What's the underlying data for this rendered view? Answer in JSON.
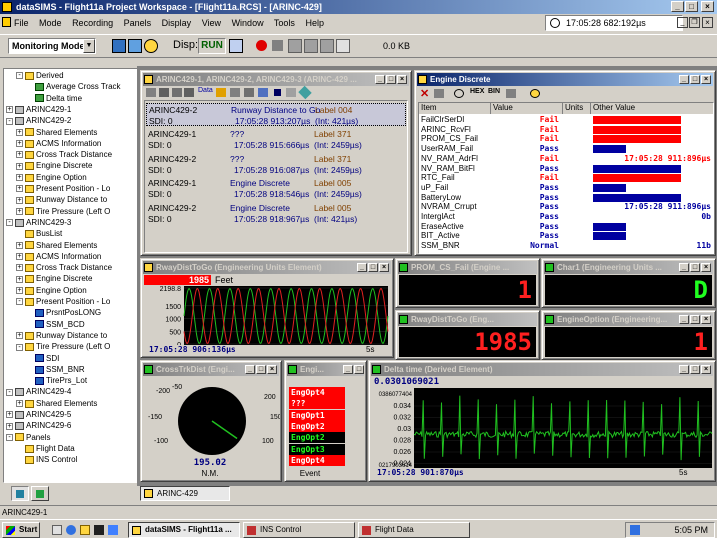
{
  "app": {
    "title": "dataSIMS - Flight11a Project Workspace - [Flight11a.RCS] - [ARINC-429]"
  },
  "menu": [
    "File",
    "Mode",
    "Recording",
    "Panels",
    "Display",
    "View",
    "Window",
    "Tools",
    "Help"
  ],
  "clock": "17:05:28 682:192µs",
  "toolbar": {
    "mode": "Monitoring Mode",
    "disp_label": "Disp:",
    "run_label": "RUN",
    "size": "0.0 KB"
  },
  "tree": [
    {
      "t": "Derived",
      "lvl": 1,
      "ic": "f",
      "pm": "-"
    },
    {
      "t": "Average Cross Track",
      "lvl": 2,
      "ic": "g"
    },
    {
      "t": "Delta time",
      "lvl": 2,
      "ic": "g"
    },
    {
      "t": "ARINC429-1",
      "lvl": 0,
      "ic": "d",
      "pm": "+"
    },
    {
      "t": "ARINC429-2",
      "lvl": 0,
      "ic": "d",
      "pm": "-"
    },
    {
      "t": "Shared Elements",
      "lvl": 1,
      "ic": "f",
      "pm": "+"
    },
    {
      "t": "ACMS Information",
      "lvl": 1,
      "ic": "f",
      "pm": "+"
    },
    {
      "t": "Cross Track Distance",
      "lvl": 1,
      "ic": "f",
      "pm": "+"
    },
    {
      "t": "Engine Discrete",
      "lvl": 1,
      "ic": "f",
      "pm": "+"
    },
    {
      "t": "Engine Option",
      "lvl": 1,
      "ic": "f",
      "pm": "+"
    },
    {
      "t": "Present Position - Lo",
      "lvl": 1,
      "ic": "f",
      "pm": "+"
    },
    {
      "t": "Runway Distance to",
      "lvl": 1,
      "ic": "f",
      "pm": "+"
    },
    {
      "t": "Tire Pressure (Left O",
      "lvl": 1,
      "ic": "f",
      "pm": "+"
    },
    {
      "t": "ARINC429-3",
      "lvl": 0,
      "ic": "d",
      "pm": "-"
    },
    {
      "t": "BusList",
      "lvl": 1,
      "ic": "f"
    },
    {
      "t": "Shared Elements",
      "lvl": 1,
      "ic": "f",
      "pm": "+"
    },
    {
      "t": "ACMS Information",
      "lvl": 1,
      "ic": "f",
      "pm": "+"
    },
    {
      "t": "Cross Track Distance",
      "lvl": 1,
      "ic": "f",
      "pm": "+"
    },
    {
      "t": "Engine Discrete",
      "lvl": 1,
      "ic": "f",
      "pm": "+"
    },
    {
      "t": "Engine Option",
      "lvl": 1,
      "ic": "f",
      "pm": "+"
    },
    {
      "t": "Present Position - Lo",
      "lvl": 1,
      "ic": "f",
      "pm": "-"
    },
    {
      "t": "PrsntPosLONG",
      "lvl": 2,
      "ic": "b"
    },
    {
      "t": "SSM_BCD",
      "lvl": 2,
      "ic": "b"
    },
    {
      "t": "Runway Distance to",
      "lvl": 1,
      "ic": "f",
      "pm": "+"
    },
    {
      "t": "Tire Pressure (Left O",
      "lvl": 1,
      "ic": "f",
      "pm": "-"
    },
    {
      "t": "SDI",
      "lvl": 2,
      "ic": "b"
    },
    {
      "t": "SSM_BNR",
      "lvl": 2,
      "ic": "b"
    },
    {
      "t": "TirePrs_Lot",
      "lvl": 2,
      "ic": "b"
    },
    {
      "t": "ARINC429-4",
      "lvl": 0,
      "ic": "d",
      "pm": "-"
    },
    {
      "t": "Shared Elements",
      "lvl": 1,
      "ic": "f",
      "pm": "+"
    },
    {
      "t": "ARINC429-5",
      "lvl": 0,
      "ic": "d",
      "pm": "+"
    },
    {
      "t": "ARINC429-6",
      "lvl": 0,
      "ic": "d",
      "pm": "+"
    },
    {
      "t": "Panels",
      "lvl": 0,
      "ic": "f",
      "pm": "-"
    },
    {
      "t": "Flight Data",
      "lvl": 1,
      "ic": "f"
    },
    {
      "t": "INS Control",
      "lvl": 1,
      "ic": "f"
    }
  ],
  "bus_window": {
    "title": "ARINC429-1, ARINC429-2, ARINC429-3 (ARINC-429 ...",
    "rows": [
      {
        "bus": "ARINC429-2",
        "name": "Runway Distance to Go",
        "label": "Label 004",
        "sdi": "SDI: 0",
        "time": "17:05:28 913:207µs",
        "int": "(Int: 421µs)",
        "hl": true
      },
      {
        "bus": "ARINC429-1",
        "name": "???",
        "label": "Label 371",
        "sdi": "SDI: 0",
        "time": "17:05:28 915:666µs",
        "int": "(Int: 2459µs)"
      },
      {
        "bus": "ARINC429-2",
        "name": "???",
        "label": "Label 371",
        "sdi": "SDI: 0",
        "time": "17:05:28 916:087µs",
        "int": "(Int: 2459µs)"
      },
      {
        "bus": "ARINC429-1",
        "name": "Engine Discrete",
        "label": "Label 005",
        "sdi": "SDI: 0",
        "time": "17:05:28 918:546µs",
        "int": "(Int: 2459µs)"
      },
      {
        "bus": "ARINC429-2",
        "name": "Engine Discrete",
        "label": "Label 005",
        "sdi": "SDI: 0",
        "time": "17:05:28 918:967µs",
        "int": "(Int: 421µs)"
      }
    ]
  },
  "engine_discrete": {
    "title": "Engine Discrete",
    "cols": [
      "Item",
      "Value",
      "Units",
      "Other Value"
    ],
    "rows": [
      {
        "item": "FailClrSerDl",
        "value": "Fail",
        "bar": 0.8,
        "color": "#ff0000"
      },
      {
        "item": "ARINC_RcvFl",
        "value": "Fail",
        "bar": 0.8,
        "color": "#ff0000"
      },
      {
        "item": "PROM_CS_Fail",
        "value": "Fail",
        "bar": 0.8,
        "color": "#ff0000"
      },
      {
        "item": "UserRAM_Fail",
        "value": "Pass",
        "bar": 0.3,
        "color": "#0000a0"
      },
      {
        "item": "NV_RAM_AdrFl",
        "value": "Fail",
        "other": "17:05:28 911:896µs",
        "color": "#ff0000"
      },
      {
        "item": "NV_RAM_BitFl",
        "value": "Pass",
        "bar": 0.8,
        "color": "#0000a0"
      },
      {
        "item": "RTC_Fail",
        "value": "Fail",
        "bar": 0.8,
        "color": "#ff0000"
      },
      {
        "item": "uP_Fail",
        "value": "Pass",
        "bar": 0.3,
        "color": "#0000a0"
      },
      {
        "item": "BatteryLow",
        "value": "Pass",
        "bar": 0.8,
        "color": "#0000a0"
      },
      {
        "item": "NVRAM_Crrupt",
        "value": "Pass",
        "other": "17:05:28 911:896µs",
        "color": "#0000a0"
      },
      {
        "item": "InterglAct",
        "value": "Pass",
        "other": "0b",
        "color": "#0000a0"
      },
      {
        "item": "EraseActive",
        "value": "Pass",
        "bar": 0.3,
        "color": "#0000a0"
      },
      {
        "item": "BIT_Active",
        "value": "Pass",
        "bar": 0.3,
        "color": "#0000a0"
      },
      {
        "item": "SSM_BNR",
        "value": "Normal",
        "other": "11b",
        "color": "#0000a0"
      }
    ]
  },
  "rway": {
    "title": "RwayDistToGo (Engineering Units Element)",
    "value": "1985",
    "unit": "Feet",
    "time": "17:05:28 906:136µs",
    "span": "5s",
    "chart_data": {
      "type": "line",
      "ylim": [
        0,
        2198.8
      ],
      "yticks": [
        "2198.8",
        "1500",
        "1000",
        "500",
        "0"
      ],
      "ymax_label": "2198. 8",
      "cycles": 10
    }
  },
  "prom": {
    "title": "PROM_CS_Fail (Engine ...",
    "value": "1"
  },
  "char1": {
    "title": "Char1 (Engineering Units ...",
    "value": "D"
  },
  "rway2": {
    "title": "RwayDistToGo (Eng...",
    "value": "1985"
  },
  "engopt": {
    "title": "EngineOption (Engineering...",
    "value": "1"
  },
  "crosstrk": {
    "title": "CrossTrkDist (Engi...",
    "value": "195.02",
    "unit": "N.M.",
    "labels": [
      "-200",
      "-150",
      "-100",
      "-50",
      "200",
      "150",
      "100"
    ],
    "needle_deg": 125
  },
  "eventwin": {
    "title": "Engi...",
    "items": [
      {
        "t": "EngOpt4",
        "c": "red"
      },
      {
        "t": "???",
        "c": "red"
      },
      {
        "t": "EngOpt1",
        "c": "red"
      },
      {
        "t": "EngOpt2",
        "c": "red"
      },
      {
        "t": "EngOpt2",
        "c": "blk"
      },
      {
        "t": "EngOpt3",
        "c": "blk"
      },
      {
        "t": "EngOpt4",
        "c": "red"
      }
    ],
    "footer": "Event"
  },
  "delta": {
    "title": "Delta time (Derived Element)",
    "value": "0.0301069021",
    "ymax": "0386077404",
    "ymin": "0217903614",
    "yticks": [
      "0.034",
      "0.032",
      "0.03",
      "0.028",
      "0.026",
      "0.024"
    ],
    "time": "17:05:28 901:870µs",
    "span": "5s"
  },
  "mdi_tab": "ARINC-429",
  "status": "ARINC429-1",
  "taskbar": {
    "start": "Start",
    "buttons": [
      "dataSIMS - Flight11a ...",
      "INS Control",
      "Flight Data"
    ],
    "time": "5:05 PM"
  }
}
